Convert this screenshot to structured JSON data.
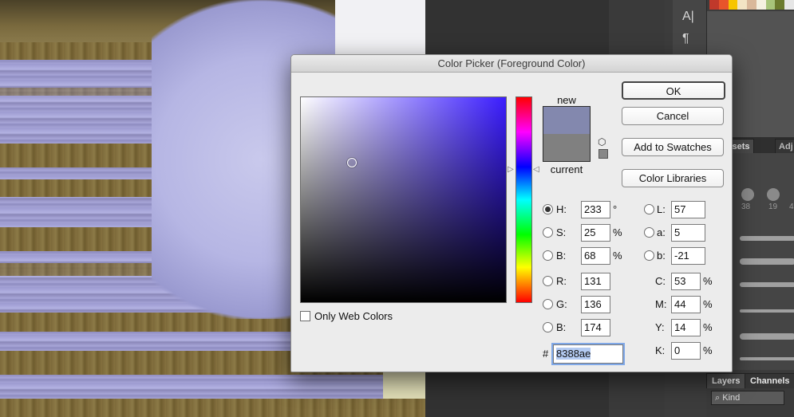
{
  "dialog": {
    "title": "Color Picker (Foreground Color)",
    "buttons": {
      "ok": "OK",
      "cancel": "Cancel",
      "add_to_swatches": "Add to Swatches",
      "color_libraries": "Color Libraries"
    },
    "preview": {
      "new_label": "new",
      "current_label": "current",
      "new_color": "#8388ae",
      "current_color": "#808080"
    },
    "hsb": {
      "h": {
        "label": "H:",
        "value": "233",
        "unit": "°",
        "selected": true
      },
      "s": {
        "label": "S:",
        "value": "25",
        "unit": "%"
      },
      "b": {
        "label": "B:",
        "value": "68",
        "unit": "%"
      }
    },
    "rgb": {
      "r": {
        "label": "R:",
        "value": "131"
      },
      "g": {
        "label": "G:",
        "value": "136"
      },
      "b": {
        "label": "B:",
        "value": "174"
      }
    },
    "lab": {
      "l": {
        "label": "L:",
        "value": "57"
      },
      "a": {
        "label": "a:",
        "value": "5"
      },
      "b": {
        "label": "b:",
        "value": "-21"
      }
    },
    "cmyk": {
      "c": {
        "label": "C:",
        "value": "53",
        "unit": "%"
      },
      "m": {
        "label": "M:",
        "value": "44",
        "unit": "%"
      },
      "y": {
        "label": "Y:",
        "value": "14",
        "unit": "%"
      },
      "k": {
        "label": "K:",
        "value": "0",
        "unit": "%"
      }
    },
    "hex": {
      "sign": "#",
      "value": "8388ae"
    },
    "only_web_colors": "Only Web Colors",
    "field_base_color": "#3b1dff"
  },
  "panels": {
    "presets_tab": "h Presets",
    "adj_tab": "Adj",
    "brush_sizes": [
      "38",
      "19",
      "4"
    ],
    "layers_tab": "Layers",
    "channels_tab": "Channels",
    "kind_filter": "Kind",
    "tool_icons": [
      "type-tool-icon",
      "paragraph-icon"
    ],
    "swatch_colors": [
      "#c0392b",
      "#e8542b",
      "#f7c500",
      "#f2e4c4",
      "#d9b89a",
      "#f4f0e0",
      "#a7c47a",
      "#6b7b2e",
      "#e6e6e6"
    ]
  }
}
